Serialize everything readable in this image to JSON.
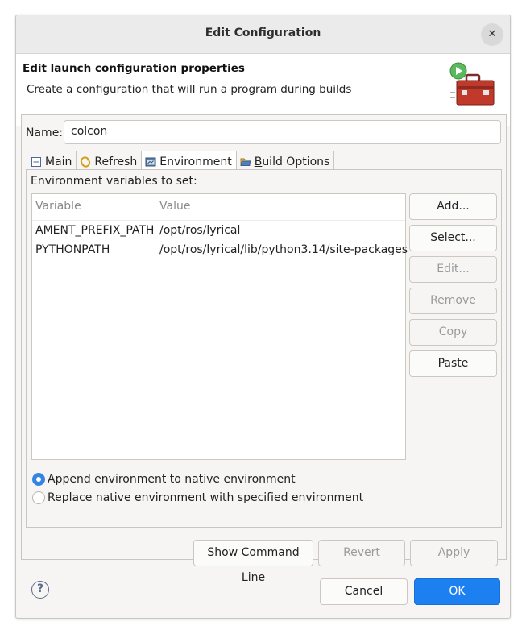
{
  "window": {
    "title": "Edit Configuration",
    "close_icon": "close-icon"
  },
  "header": {
    "title": "Edit launch configuration properties",
    "description": "Create a configuration that will run a program during builds",
    "icon": "toolbox-run-icon"
  },
  "name_field": {
    "label": "Name:",
    "value": "colcon"
  },
  "tabs": [
    {
      "label": "Main",
      "icon": "main-tab-icon",
      "active": false
    },
    {
      "label": "Refresh",
      "icon": "refresh-icon",
      "active": false
    },
    {
      "label": "Environment",
      "icon": "environment-icon",
      "active": true
    },
    {
      "label": "Build Options",
      "icon": "folder-open-icon",
      "active": false
    }
  ],
  "environment": {
    "label": "Environment variables to set:",
    "columns": [
      "Variable",
      "Value"
    ],
    "rows": [
      {
        "variable": "AMENT_PREFIX_PATH",
        "value": "/opt/ros/lyrical"
      },
      {
        "variable": "PYTHONPATH",
        "value": "/opt/ros/lyrical/lib/python3.14/site-packages"
      }
    ],
    "buttons": [
      {
        "label": "Add...",
        "enabled": true
      },
      {
        "label": "Select...",
        "enabled": true
      },
      {
        "label": "Edit...",
        "enabled": false
      },
      {
        "label": "Remove",
        "enabled": false
      },
      {
        "label": "Copy",
        "enabled": false
      },
      {
        "label": "Paste",
        "enabled": true
      }
    ],
    "options": [
      {
        "label": "Append environment to native environment",
        "selected": true
      },
      {
        "label": "Replace native environment with specified environment",
        "selected": false
      }
    ]
  },
  "panel_buttons": {
    "show_command_line": "Show Command Line",
    "revert": "Revert",
    "apply": "Apply"
  },
  "footer": {
    "help_icon": "help-icon",
    "cancel": "Cancel",
    "ok": "OK"
  },
  "colors": {
    "accent": "#1c80f0",
    "radio_selected": "#3584e4"
  }
}
